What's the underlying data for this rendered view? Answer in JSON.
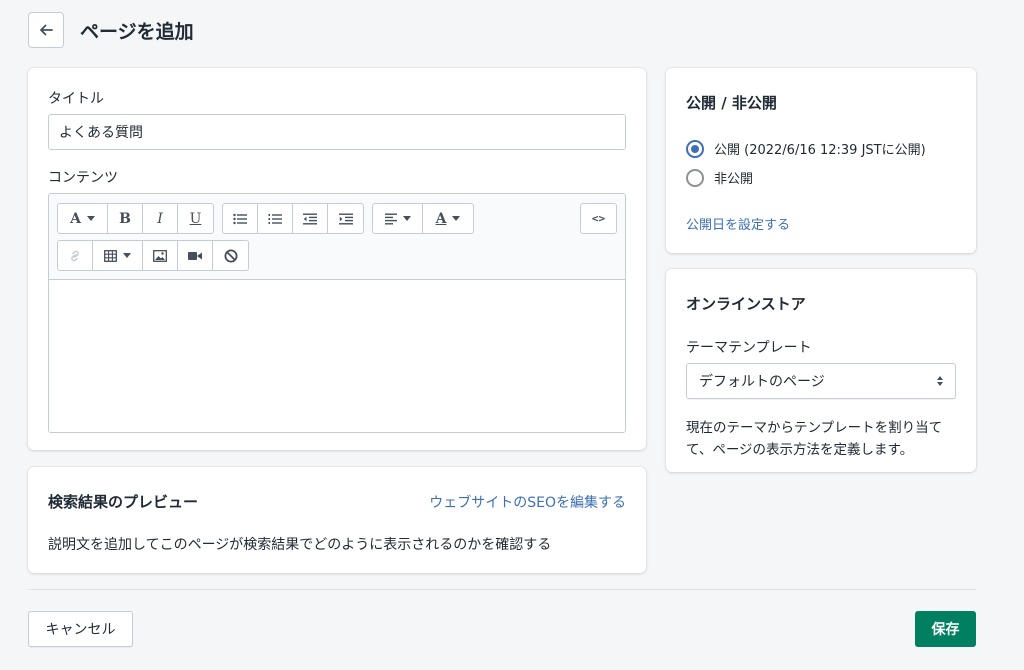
{
  "header": {
    "title": "ページを追加",
    "back_icon": "arrow-left-icon"
  },
  "main": {
    "title_label": "タイトル",
    "title_value": "よくある質問",
    "content_label": "コンテンツ",
    "toolbar": {
      "row1": [
        {
          "name": "text-style",
          "glyph": "A",
          "dropdown": true
        },
        {
          "name": "bold",
          "glyph": "B"
        },
        {
          "name": "italic",
          "glyph": "I"
        },
        {
          "name": "underline",
          "glyph": "U"
        },
        {
          "name": "bullet-list",
          "icon": "bullet-list-icon"
        },
        {
          "name": "numbered-list",
          "icon": "numbered-list-icon"
        },
        {
          "name": "outdent",
          "icon": "outdent-icon"
        },
        {
          "name": "indent",
          "icon": "indent-icon"
        },
        {
          "name": "align",
          "icon": "align-left-icon",
          "dropdown": true
        },
        {
          "name": "text-color",
          "glyph": "A",
          "dropdown": true
        }
      ],
      "html_button": "<>",
      "row2": [
        "link-icon",
        "table-icon",
        "image-icon",
        "video-icon",
        "clear-format-icon"
      ]
    }
  },
  "seo": {
    "title": "検索結果のプレビュー",
    "edit_link": "ウェブサイトのSEOを編集する",
    "description": "説明文を追加してこのページが検索結果でどのように表示されるのかを確認する"
  },
  "visibility": {
    "title": "公開 / 非公開",
    "options": [
      {
        "label": "公開 (2022/6/16 12:39 JSTに公開)",
        "checked": true
      },
      {
        "label": "非公開",
        "checked": false
      }
    ],
    "set_date_link": "公開日を設定する"
  },
  "online_store": {
    "title": "オンラインストア",
    "template_label": "テーマテンプレート",
    "template_value": "デフォルトのページ",
    "help": "現在のテーマからテンプレートを割り当てて、ページの表示方法を定義します。"
  },
  "footer": {
    "cancel": "キャンセル",
    "save": "保存"
  },
  "colors": {
    "primary": "#008060",
    "link": "#3c6fb5",
    "background": "#f4f6f8"
  }
}
